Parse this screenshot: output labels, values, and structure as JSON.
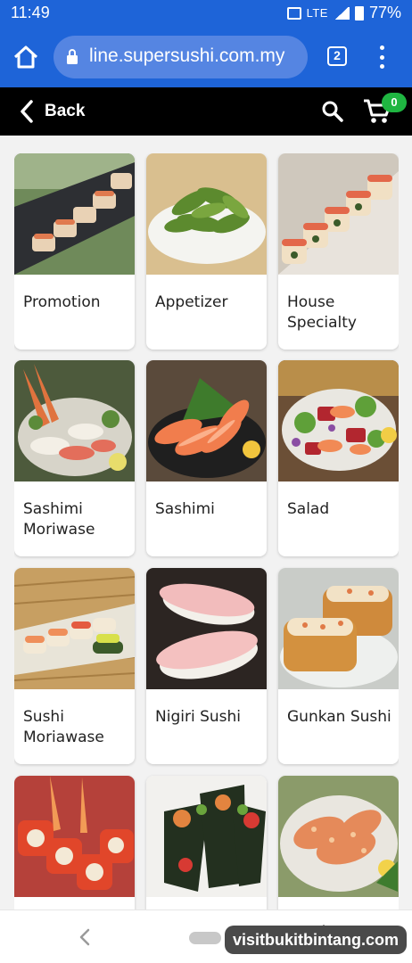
{
  "status_bar": {
    "time": "11:49",
    "network": "LTE",
    "battery": "77%"
  },
  "browser": {
    "url": "line.supersushi.com.my",
    "tab_count": "2"
  },
  "header": {
    "back_label": "Back",
    "cart_count": "0"
  },
  "categories": [
    {
      "label": "Promotion"
    },
    {
      "label": "Appetizer"
    },
    {
      "label": "House Specialty"
    },
    {
      "label": "Sashimi Moriwase"
    },
    {
      "label": "Sashimi"
    },
    {
      "label": "Salad"
    },
    {
      "label": "Sushi Moriawase"
    },
    {
      "label": "Nigiri Sushi"
    },
    {
      "label": "Gunkan Sushi"
    },
    {
      "label": ""
    },
    {
      "label": ""
    },
    {
      "label": ""
    }
  ],
  "watermark": "visitbukitbintang.com",
  "colors": {
    "browser_blue": "#1e64d8",
    "badge_green": "#1fb541",
    "header_black": "#000000"
  }
}
